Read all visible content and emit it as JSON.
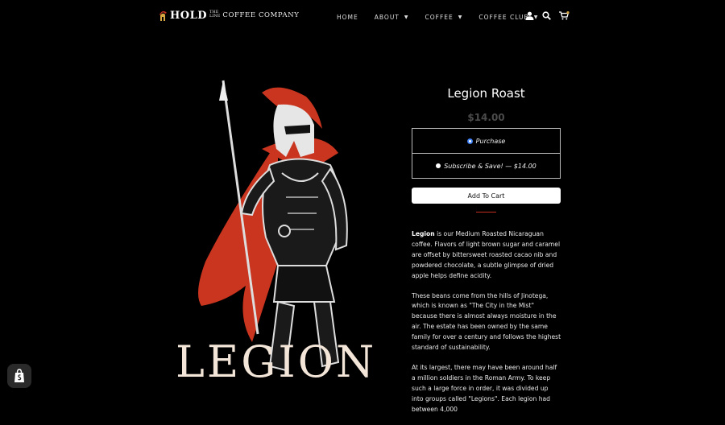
{
  "brand": {
    "logo_main": "HOLD",
    "logo_small_1": "THE",
    "logo_small_2": "LINE",
    "logo_company": "COFFEE COMPANY"
  },
  "nav": {
    "items": [
      {
        "label": "HOME",
        "has_menu": false
      },
      {
        "label": "ABOUT",
        "has_menu": true
      },
      {
        "label": "COFFEE",
        "has_menu": true
      },
      {
        "label": "COFFEE CLUB",
        "has_menu": true
      }
    ],
    "icons": [
      "user-icon",
      "search-icon",
      "cart-icon"
    ]
  },
  "hero": {
    "word": "LEGION"
  },
  "product": {
    "title": "Legion Roast",
    "price": "$14.00",
    "options": [
      {
        "label": "Purchase",
        "selected": true
      },
      {
        "label": "Subscribe & Save! — $14.00",
        "selected": false
      }
    ],
    "add_to_cart": "Add To Cart",
    "desc_lead": "Legion",
    "desc_p1": " is our Medium Roasted Nicaraguan coffee. Flavors of light brown sugar and caramel are offset by bittersweet roasted cacao nib and powdered chocolate, a subtle glimpse of dried apple helps define acidity.",
    "desc_p2": "These beans come from the hills of Jinotega, which is known as \"The City in the Mist\" because there is almost always moisture in the air. The estate has been owned by the same family for over a century and follows the highest standard of sustainability.",
    "desc_p3": "At its largest, there may have been around half a million soldiers in the Roman Army. To keep such a large force in order, it was divided up into groups called \"Legions\". Each legion had between 4,000"
  },
  "colors": {
    "background": "#000000",
    "accent": "#c22e20",
    "price": "#4b4b4b"
  }
}
